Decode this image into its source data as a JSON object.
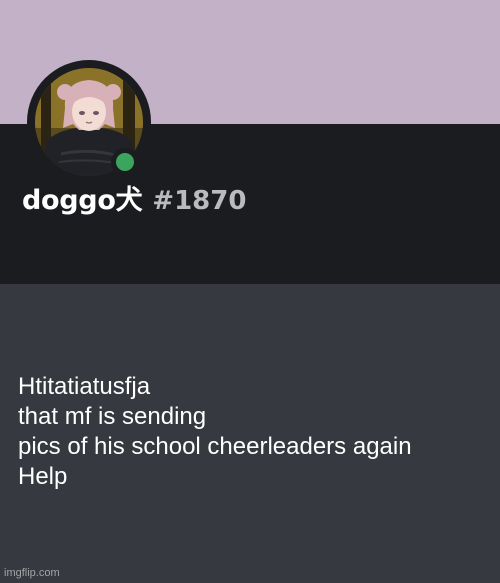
{
  "profile": {
    "username": "doggo犬",
    "discriminator": "#1870",
    "status": "online",
    "colors": {
      "banner": "#c3b1c8",
      "header": "#1b1c1f",
      "body": "#36393f",
      "status_online": "#3ba55d",
      "discriminator": "#b9bbbe"
    }
  },
  "message": {
    "lines": [
      "Htitatiatusfja",
      "that mf is sending",
      "pics of his school cheerleaders again",
      "Help"
    ]
  },
  "watermark": "imgflip.com"
}
